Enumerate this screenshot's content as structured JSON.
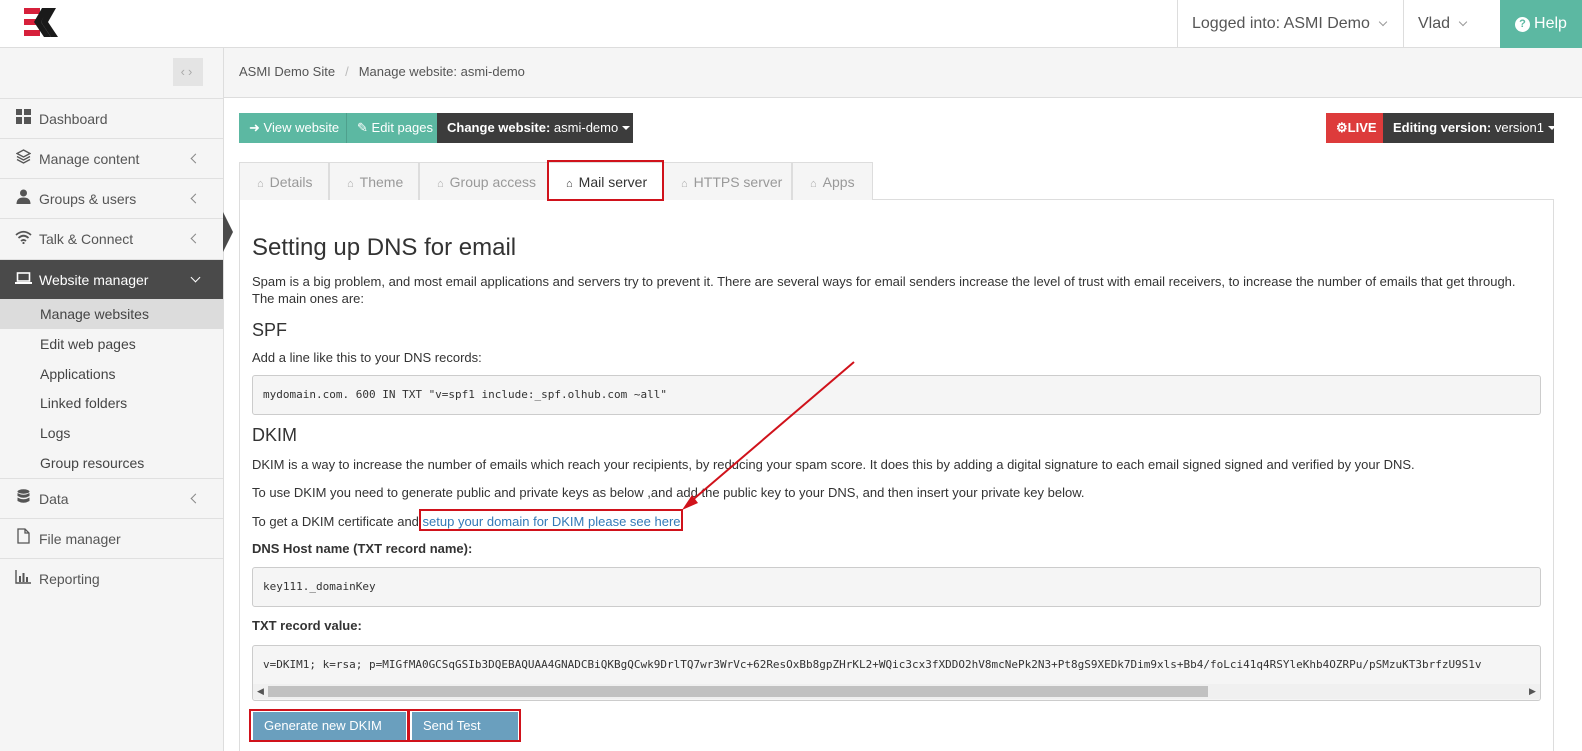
{
  "topbar": {
    "logged_in": "Logged into: ASMI Demo",
    "user": "Vlad",
    "help": "Help"
  },
  "sidebar": {
    "items": [
      {
        "label": "Dashboard",
        "icon": "dashboard-icon"
      },
      {
        "label": "Manage content",
        "icon": "layers-icon"
      },
      {
        "label": "Groups & users",
        "icon": "user-icon"
      },
      {
        "label": "Talk & Connect",
        "icon": "wifi-icon"
      },
      {
        "label": "Website manager",
        "icon": "laptop-icon"
      },
      {
        "label": "Data",
        "icon": "database-icon"
      },
      {
        "label": "File manager",
        "icon": "file-icon"
      },
      {
        "label": "Reporting",
        "icon": "bar-chart-icon"
      }
    ],
    "subitems": [
      "Manage websites",
      "Edit web pages",
      "Applications",
      "Linked folders",
      "Logs",
      "Group resources"
    ]
  },
  "breadcrumb": {
    "root": "ASMI Demo Site",
    "current": "Manage website: asmi-demo"
  },
  "toolbar": {
    "view_website": "View website",
    "edit_pages": "Edit pages",
    "change_website_label": "Change website:",
    "change_website_value": "asmi-demo",
    "live": "LIVE",
    "editing_version_label": "Editing version:",
    "editing_version_value": "version1"
  },
  "tabs": [
    "Details",
    "Theme",
    "Group access",
    "Mail server",
    "HTTPS server",
    "Apps"
  ],
  "content": {
    "title": "Setting up DNS for email",
    "intro": "Spam is a big problem, and most email applications and servers try to prevent it. There are several ways for email senders increase the level of trust with email receivers, to increase the number of emails that get through. The main ones are:",
    "spf_heading": "SPF",
    "spf_text": "Add a line like this to your DNS records:",
    "spf_record": "mydomain.com. 600 IN TXT \"v=spf1 include:_spf.olhub.com ~all\"",
    "dkim_heading": "DKIM",
    "dkim_text1": "DKIM is a way to increase the number of emails which reach your recipients, by reducing your spam score. It does this by adding a digital signature to each email signed signed and verified by your DNS.",
    "dkim_text2": "To use DKIM you need to generate public and private keys as below ,and add the public key to your DNS, and then insert your private key below.",
    "dkim_text3_prefix": "To get a DKIM certificate and ",
    "dkim_link": "setup your domain for DKIM please see here",
    "host_label": "DNS Host name (TXT record name):",
    "host_value": "key111._domainKey",
    "txt_label": "TXT record value:",
    "txt_value": "v=DKIM1; k=rsa; p=MIGfMA0GCSqGSIb3DQEBAQUAA4GNADCBiQKBgQCwk9DrlTQ7wr3WrVc+62ResOxBb8gpZHrKL2+WQic3cx3fXDDO2hV8mcNePk2N3+Pt8gS9XEDk7Dim9xls+Bb4/foLci41q4RSYleKhb4OZRPu/pSMzuKT3brfzU9S1v",
    "generate_btn": "Generate new DKIM key",
    "test_btn": "Send Test Email"
  }
}
